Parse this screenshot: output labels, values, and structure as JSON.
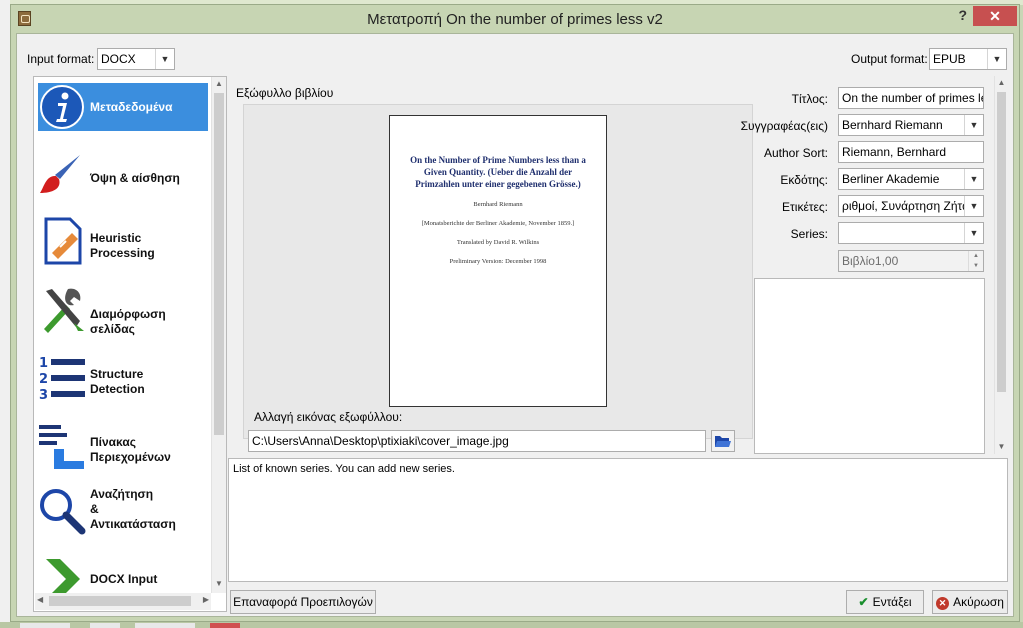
{
  "window": {
    "title": "Μετατροπή On the number of primes less v2",
    "help": "?",
    "close": "✕"
  },
  "input_format": {
    "label": "Input format:",
    "value": "DOCX"
  },
  "output_format": {
    "label": "Output format:",
    "value": "EPUB"
  },
  "sidebar": {
    "items": [
      {
        "label": "Μεταδεδομένα",
        "icon": "info-icon",
        "selected": true
      },
      {
        "label": "Όψη & αίσθηση",
        "icon": "paintbrush-icon",
        "selected": false
      },
      {
        "label": "Heuristic\nProcessing",
        "icon": "heuristic-document-icon",
        "selected": false
      },
      {
        "label": "Διαμόρφωση σελίδας",
        "icon": "tools-icon",
        "selected": false
      },
      {
        "label": "Structure\nDetection",
        "icon": "numbered-list-icon",
        "selected": false
      },
      {
        "label": "Πίνακας\nΠεριεχομένων",
        "icon": "toc-icon",
        "selected": false
      },
      {
        "label": "Αναζήτηση\n&\nΑντικατάσταση",
        "icon": "magnifier-icon",
        "selected": false
      },
      {
        "label": "DOCX Input",
        "icon": "chevron-right-icon",
        "selected": false
      }
    ]
  },
  "cover": {
    "section_label": "Εξώφυλλο βιβλίου",
    "page": {
      "title": "On the Number of Prime Numbers less than a Given Quantity. (Ueber die Anzahl der Primzahlen unter einer gegebenen Grösse.)",
      "author": "Bernhard Riemann",
      "source": "[Monatsberichte der Berliner Akademie, November 1859.]",
      "translator": "Translated by David R. Wilkins",
      "version": "Preliminary Version: December 1998"
    },
    "change_label": "Αλλαγή εικόνας εξωφύλλου:",
    "path": "C:\\Users\\Anna\\Desktop\\ptixiaki\\cover_image.jpg",
    "browse_icon": "folder-open-icon"
  },
  "metadata": {
    "title_label": "Τίτλος:",
    "title_value": "On the number of primes less v",
    "author_label": "Συγγραφέας(εις)",
    "author_value": "Bernhard Riemann",
    "author_sort_label": "Author Sort:",
    "author_sort_value": "Riemann, Bernhard",
    "publisher_label": "Εκδότης:",
    "publisher_value": "Berliner Akademie",
    "tags_label": "Ετικέτες:",
    "tags_value": "ριθμοί, Συνάρτηση Ζήτα,",
    "series_label": "Series:",
    "series_value": "",
    "series_index": "Βιβλίο1,00"
  },
  "help_text": "List of known series. You can add new series.",
  "buttons": {
    "reset": "Επαναφορά Προεπιλογών",
    "ok": "Εντάξει",
    "cancel": "Ακύρωση"
  },
  "colors": {
    "selection": "#3b8ede",
    "ok_check": "#1a8f2e",
    "cancel_x": "#c0392b",
    "close_button": "#c75050"
  }
}
